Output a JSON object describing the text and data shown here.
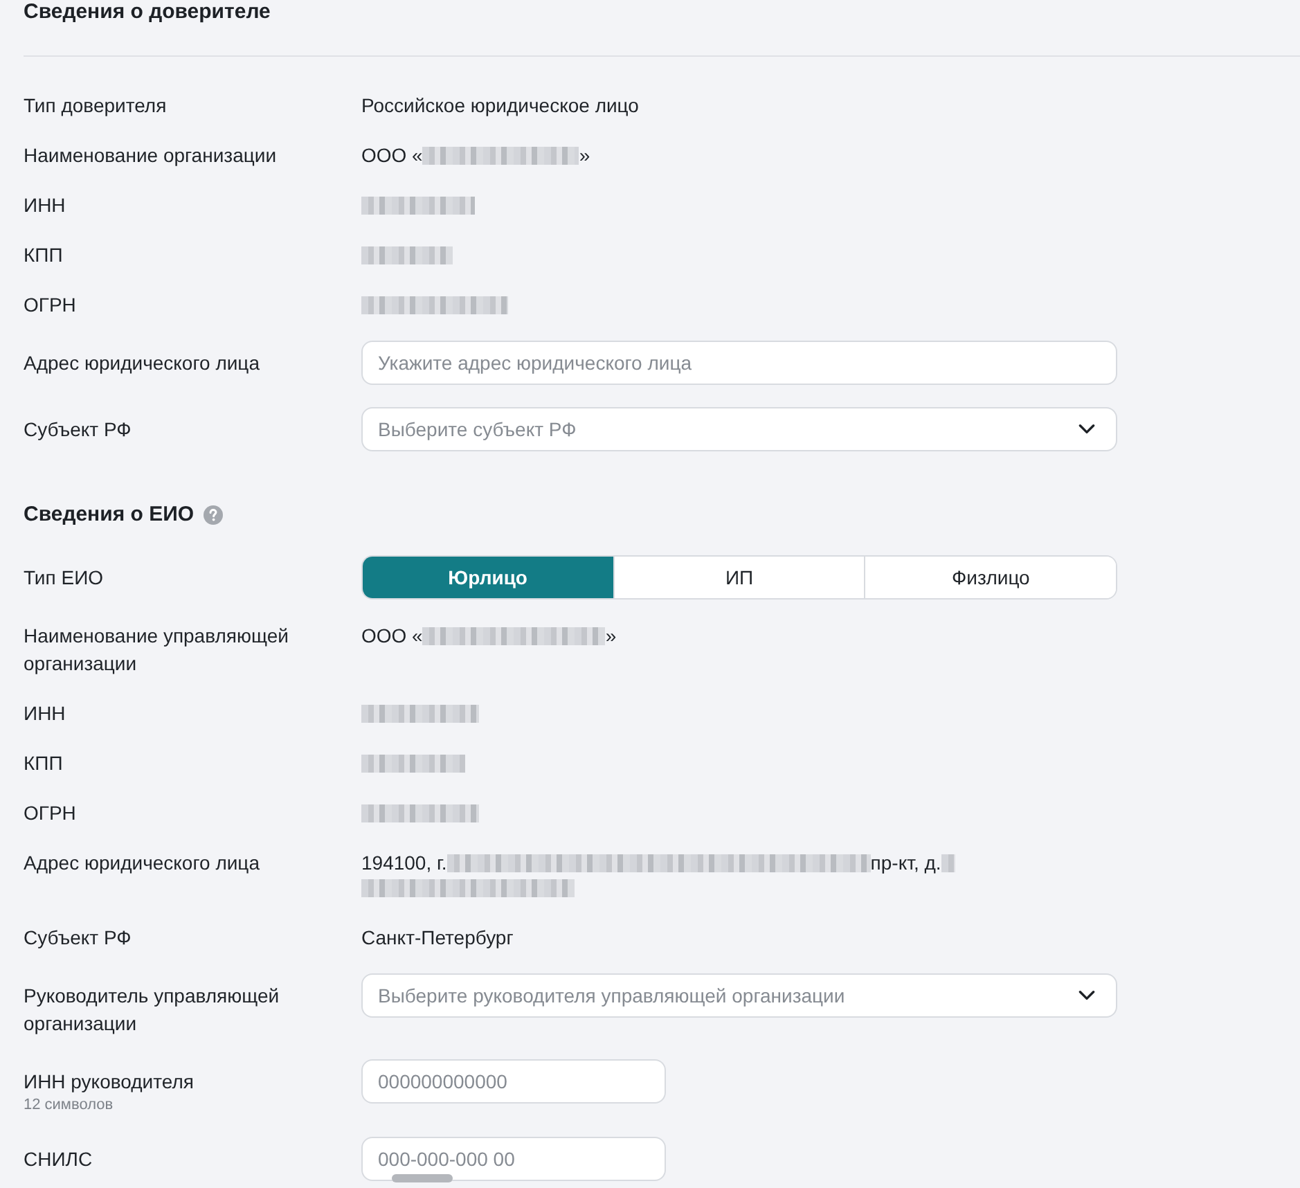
{
  "sections": [
    {
      "title": "Сведения о доверителе",
      "underlined": true,
      "help": false,
      "rows": [
        {
          "kind": "text",
          "label": "Тип доверителя",
          "value": [
            {
              "kind": "text",
              "text": "Российское юридическое лицо"
            }
          ]
        },
        {
          "kind": "text",
          "label": "Наименование организации",
          "value": [
            {
              "kind": "text",
              "text": "ООО «"
            },
            {
              "kind": "redacted"
            },
            {
              "kind": "text",
              "text": "»"
            }
          ]
        },
        {
          "kind": "text",
          "label": "ИНН",
          "value": [
            {
              "kind": "redacted"
            }
          ]
        },
        {
          "kind": "text",
          "label": "КПП",
          "value": [
            {
              "kind": "redacted"
            }
          ]
        },
        {
          "kind": "text",
          "label": "ОГРН",
          "value": [
            {
              "kind": "redacted"
            }
          ]
        },
        {
          "kind": "input",
          "label": "Адрес юридического лица",
          "placeholder": "Укажите адрес юридического лица"
        },
        {
          "kind": "select",
          "label": "Субъект РФ",
          "placeholder": "Выберите субъект РФ"
        }
      ]
    },
    {
      "title": "Сведения о ЕИО",
      "underlined": false,
      "help": true,
      "rows": [
        {
          "kind": "segmented",
          "label": "Тип ЕИО",
          "options": [
            {
              "label": "Юрлицо",
              "selected": true
            },
            {
              "label": "ИП",
              "selected": false
            },
            {
              "label": "Физлицо",
              "selected": false
            }
          ]
        },
        {
          "kind": "text",
          "label": "Наименование управляющей организации",
          "value": [
            {
              "kind": "text",
              "text": "ООО «"
            },
            {
              "kind": "redacted"
            },
            {
              "kind": "text",
              "text": "»"
            }
          ]
        },
        {
          "kind": "text",
          "label": "ИНН",
          "value": [
            {
              "kind": "redacted"
            }
          ]
        },
        {
          "kind": "text",
          "label": "КПП",
          "value": [
            {
              "kind": "redacted"
            }
          ]
        },
        {
          "kind": "text",
          "label": "ОГРН",
          "value": [
            {
              "kind": "redacted"
            }
          ]
        },
        {
          "kind": "text",
          "label": "Адрес юридического лица",
          "value": [
            {
              "kind": "text",
              "text": "194100, г."
            },
            {
              "kind": "redacted"
            },
            {
              "kind": "text",
              "text": "пр-кт, д."
            },
            {
              "kind": "redacted"
            },
            {
              "kind": "redacted"
            }
          ]
        },
        {
          "kind": "text",
          "label": "Субъект РФ",
          "value": [
            {
              "kind": "text",
              "text": "Санкт-Петербург"
            }
          ]
        },
        {
          "kind": "select",
          "label": "Руководитель управляющей организации",
          "placeholder": "Выберите руководителя управляющей организации"
        },
        {
          "kind": "number",
          "label": "ИНН руководителя",
          "hint": "12 символов",
          "placeholder": "000000000000"
        },
        {
          "kind": "number",
          "label": "СНИЛС",
          "placeholder": "000-000-000 00"
        }
      ]
    }
  ]
}
